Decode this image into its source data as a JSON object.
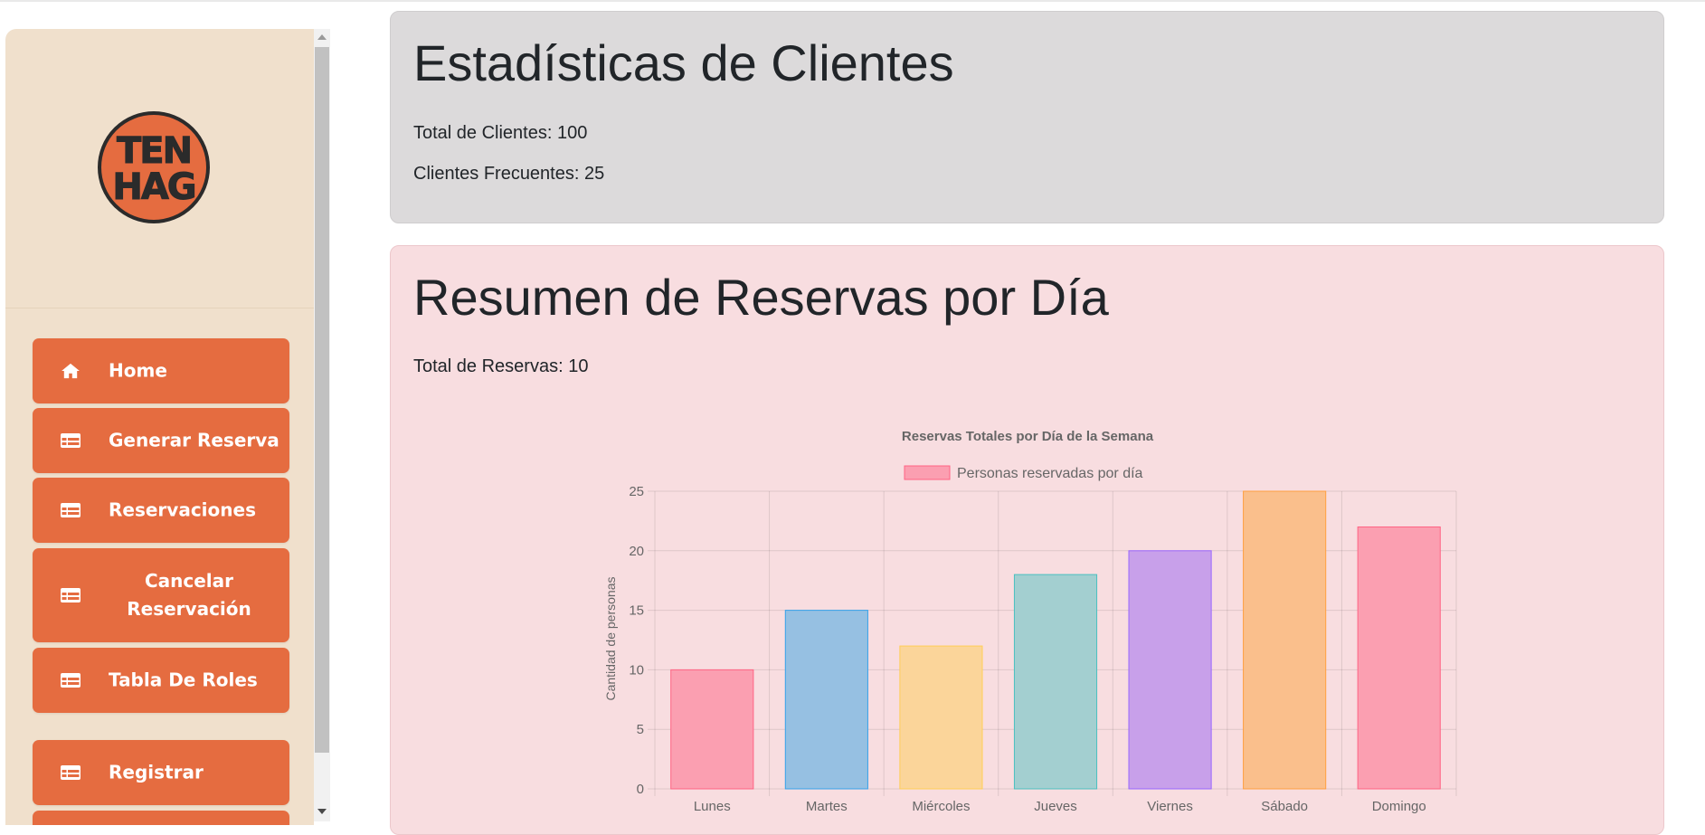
{
  "sidebar": {
    "logo": {
      "line1": "TEN",
      "line2": "HAG",
      "bg": "#e56c40",
      "ink": "#2b2b2b"
    },
    "items": [
      {
        "label": "Home",
        "icon": "home-icon"
      },
      {
        "label": "Generar Reserva",
        "icon": "table-icon"
      },
      {
        "label": "Reservaciones",
        "icon": "table-icon"
      },
      {
        "label": "Cancelar Reservación",
        "icon": "table-icon"
      },
      {
        "label": "Tabla De Roles",
        "icon": "table-icon"
      },
      {
        "label": "Registrar",
        "icon": "table-icon"
      }
    ],
    "accent": "#e56c40",
    "background": "#f0e0cc"
  },
  "stats": {
    "title": "Estadísticas de Clientes",
    "total_clientes": "Total de Clientes: 100",
    "clientes_frecuentes": "Clientes Frecuentes: 25"
  },
  "reservas": {
    "title": "Resumen de Reservas por Día",
    "total_reservas": "Total de Reservas: 10"
  },
  "chart_data": {
    "type": "bar",
    "title": "Reservas Totales por Día de la Semana",
    "legend": "Personas reservadas por día",
    "legend_position": "top",
    "ylabel": "Cantidad de personas",
    "xlabel": "",
    "categories": [
      "Lunes",
      "Martes",
      "Miércoles",
      "Jueves",
      "Viernes",
      "Sábado",
      "Domingo"
    ],
    "values": [
      10,
      15,
      12,
      18,
      20,
      25,
      22
    ],
    "ylim": [
      0,
      25
    ],
    "yticks": [
      0,
      5,
      10,
      15,
      20,
      25
    ],
    "grid": true,
    "fills": [
      "#fb9fb1",
      "#96c0e2",
      "#fbd59a",
      "#a3cfd0",
      "#c8a0ea",
      "#fabf8c",
      "#fb9fb1"
    ],
    "strokes": [
      "#ff6384",
      "#36a2eb",
      "#ffce56",
      "#4bc0c0",
      "#9966ff",
      "#ff9f40",
      "#ff6384"
    ]
  }
}
